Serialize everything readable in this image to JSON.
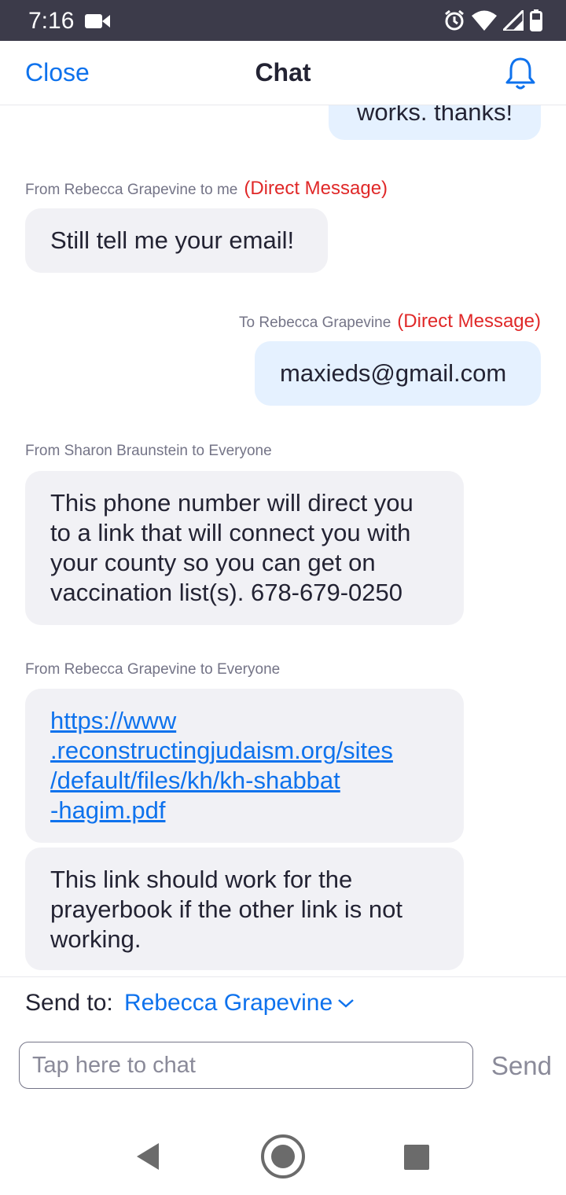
{
  "status_bar": {
    "time": "7:16"
  },
  "header": {
    "close_label": "Close",
    "title": "Chat"
  },
  "messages": [
    {
      "text": "works. thanks!"
    },
    {
      "meta": "From Rebecca Grapevine to me",
      "dm": "(Direct Message)",
      "text": "Still tell me your email!"
    },
    {
      "meta": "To Rebecca Grapevine",
      "dm": "(Direct Message)",
      "text": "maxieds@gmail.com"
    },
    {
      "meta": "From Sharon Braunstein to Everyone",
      "text": "This phone number will direct you to a link that will connect you with your county so you can get on vaccination list(s).  678-679-0250"
    },
    {
      "meta": "From Rebecca Grapevine to Everyone",
      "link_lines": [
        "https://www",
        ".reconstructingjudaism.org/sites",
        "/default/files/kh/kh-shabbat",
        "-hagim.pdf"
      ]
    },
    {
      "text": "This link should work for the prayerbook if the other link is not working."
    }
  ],
  "composer": {
    "send_to_label": "Send to:",
    "send_to_value": "Rebecca Grapevine",
    "input_placeholder": "Tap here to chat",
    "send_label": "Send"
  },
  "colors": {
    "accent": "#0e72ed",
    "dm": "#e02828",
    "incoming_bubble": "#f1f1f5",
    "outgoing_bubble": "#e5f1ff",
    "status_bar": "#3c3b4a"
  },
  "icons": [
    "video-camera-icon",
    "alarm-icon",
    "wifi-icon",
    "signal-icon",
    "battery-icon",
    "bell-icon",
    "chevron-down-icon",
    "back-icon",
    "home-icon",
    "recent-apps-icon"
  ]
}
